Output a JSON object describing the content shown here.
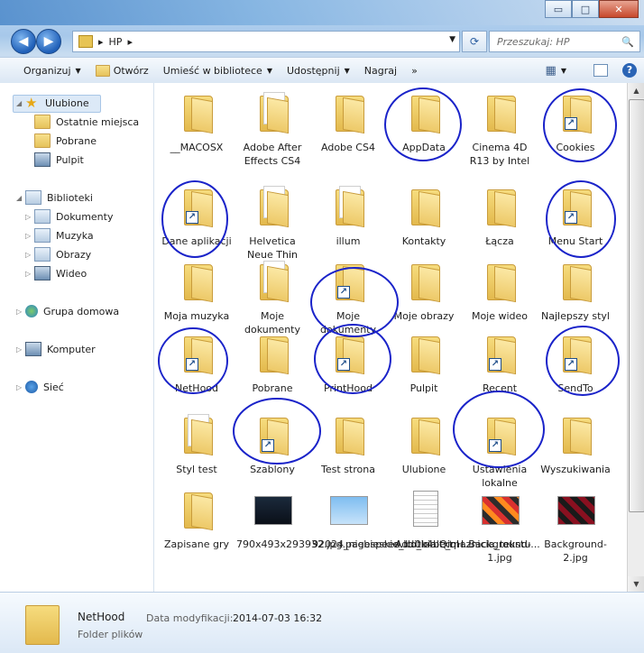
{
  "window": {
    "minimize": "▭",
    "maximize": "□",
    "close": "✕"
  },
  "address": {
    "path": "HP",
    "separator": "▸"
  },
  "search": {
    "placeholder": "Przeszukaj: HP"
  },
  "toolbar": {
    "organize": "Organizuj",
    "open": "Otwórz",
    "include": "Umieść w bibliotece",
    "share": "Udostępnij",
    "burn": "Nagraj",
    "more": "»"
  },
  "nav": {
    "favorites": "Ulubione",
    "recent": "Ostatnie miejsca",
    "downloads": "Pobrane",
    "desktop": "Pulpit",
    "libraries": "Biblioteki",
    "documents": "Dokumenty",
    "music": "Muzyka",
    "pictures": "Obrazy",
    "video": "Wideo",
    "homegroup": "Grupa domowa",
    "computer": "Komputer",
    "network": "Sieć"
  },
  "items": [
    {
      "label": "__MACOSX",
      "kind": "folder"
    },
    {
      "label": "Adobe After Effects CS4",
      "kind": "folder-doc"
    },
    {
      "label": "Adobe CS4",
      "kind": "folder"
    },
    {
      "label": "AppData",
      "kind": "folder"
    },
    {
      "label": "Cinema 4D R13 by Intel",
      "kind": "folder"
    },
    {
      "label": "Cookies",
      "kind": "shortcut"
    },
    {
      "label": "Dane aplikacji",
      "kind": "shortcut"
    },
    {
      "label": "Helvetica Neue Thin",
      "kind": "folder-doc"
    },
    {
      "label": "illum",
      "kind": "folder-doc"
    },
    {
      "label": "Kontakty",
      "kind": "folder"
    },
    {
      "label": "Łącza",
      "kind": "folder"
    },
    {
      "label": "Menu Start",
      "kind": "shortcut"
    },
    {
      "label": "Moja muzyka",
      "kind": "folder"
    },
    {
      "label": "Moje dokumenty",
      "kind": "folder-doc"
    },
    {
      "label": "Moje dokumenty",
      "kind": "shortcut"
    },
    {
      "label": "Moje obrazy",
      "kind": "folder"
    },
    {
      "label": "Moje wideo",
      "kind": "folder"
    },
    {
      "label": "Najlepszy styl",
      "kind": "folder"
    },
    {
      "label": "NetHood",
      "kind": "shortcut"
    },
    {
      "label": "Pobrane",
      "kind": "folder"
    },
    {
      "label": "PrintHood",
      "kind": "shortcut"
    },
    {
      "label": "Pulpit",
      "kind": "folder"
    },
    {
      "label": "Recent",
      "kind": "shortcut"
    },
    {
      "label": "SendTo",
      "kind": "shortcut"
    },
    {
      "label": "Styl test",
      "kind": "folder-doc"
    },
    {
      "label": "Szablony",
      "kind": "shortcut"
    },
    {
      "label": "Test strona",
      "kind": "folder"
    },
    {
      "label": "Ulubione",
      "kind": "folder"
    },
    {
      "label": "Ustawienia lokalne",
      "kind": "shortcut"
    },
    {
      "label": "Wyszukiwania",
      "kind": "folder"
    },
    {
      "label": "Zapisane gry",
      "kind": "folder"
    },
    {
      "label": "790x493x293932.jpg.pagespeed.ic.0k4bQiqH...",
      "kind": "image"
    },
    {
      "label": "92024_niebieskie_tlo_biale_maznicia_tekstu...",
      "kind": "image"
    },
    {
      "label": "Addition.txt",
      "kind": "text"
    },
    {
      "label": "Background-1.jpg",
      "kind": "image"
    },
    {
      "label": "Background-2.jpg",
      "kind": "image"
    }
  ],
  "status": {
    "name": "NetHood",
    "type": "Folder plików",
    "modified_label": "Data modyfikacji:",
    "modified": "2014-07-03 16:32"
  }
}
